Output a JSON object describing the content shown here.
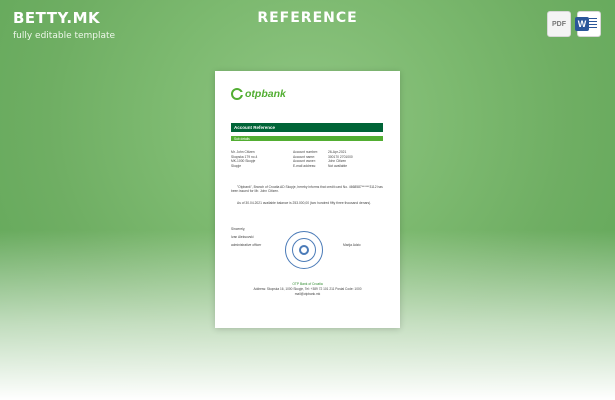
{
  "header": {
    "brand": "BETTY.MK",
    "tagline": "fully editable template",
    "title": "REFERENCE",
    "file_icons": [
      {
        "label": "PDF",
        "icon": "pdf-file-icon"
      },
      {
        "label": "W",
        "icon": "word-file-icon"
      }
    ]
  },
  "document": {
    "bank_name": "otpbank",
    "title_bar": "Account Reference",
    "subtitle_bar": "Sub details",
    "left_column": [
      "Mr. John Citizen",
      "Skopska 179 no.4",
      "MK-1000 Skopje",
      "Skopje"
    ],
    "mid_column": [
      "Account number:",
      "Account name:",
      "Account owner:",
      "E-mail address:"
    ],
    "right_column": [
      "26-Apr-2021",
      "300170 2701000",
      "John Citizen",
      "Not available"
    ],
    "paragraph_1": "\"Otpbank\", Branch of Croatia AD Skopje, hereby informs that credit card No. 4668587******3112 has been issued for Mr. John Citizen.",
    "paragraph_2": "As of 30.04.2021 available balance is 253.000,00 (two hundred fifty three thousand denars).",
    "closing": "Sincerely,",
    "officer_name": "Ivan Aleksovski",
    "officer_role": "administrative officer",
    "manager": "Marija Adzic",
    "footer_bank": "OTP Bank of Croatia",
    "footer_address": "Address: Skopska 16, 1000 Skopje, Tel: +389 72 101 211 Postal Code: 1000",
    "footer_email": "mail@otpbank.mk"
  },
  "colors": {
    "background": "#7cb96f",
    "otp_green": "#52ae32",
    "otp_dark_green": "#006437",
    "seal_blue": "#4b7bb8"
  }
}
